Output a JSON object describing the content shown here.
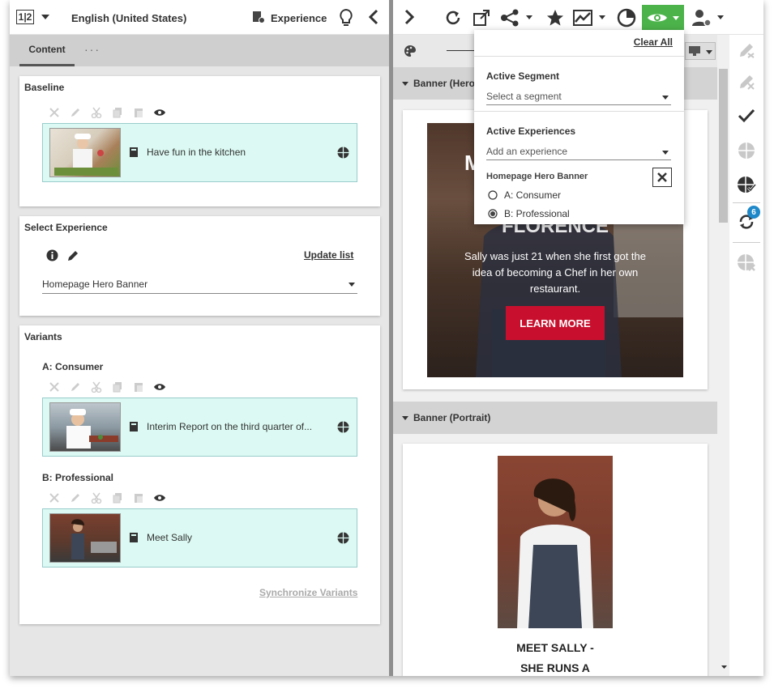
{
  "toolbar": {
    "page_icon_text": "1|2",
    "language": "English (United States)",
    "experience_label": "Experience",
    "visibility_color": "#4cb34a"
  },
  "tabs": {
    "content": "Content",
    "more": "···"
  },
  "baseline": {
    "title": "Baseline",
    "item_label": "Have fun in the kitchen"
  },
  "select_experience": {
    "title": "Select Experience",
    "update_list": "Update list",
    "selected": "Homepage Hero Banner"
  },
  "variants": {
    "title": "Variants",
    "a_title": "A: Consumer",
    "a_item": "Interim Report on the third quarter of...",
    "b_title": "B: Professional",
    "b_item": "Meet Sally",
    "sync": "Synchronize Variants"
  },
  "preview": {
    "hero_header": "Banner (Hero)",
    "hero_title_top": "M",
    "hero_title_2": "FLORENCE",
    "hero_text": "Sally was just 21 when she first got the idea of becoming a Chef in her own restaurant.",
    "hero_button": "LEARN MORE",
    "portrait_header": "Banner (Portrait)",
    "portrait_caption_1": "MEET SALLY -",
    "portrait_caption_2": "SHE RUNS A"
  },
  "dropdown": {
    "clear_all": "Clear All",
    "segment_label": "Active Segment",
    "segment_placeholder": "Select a segment",
    "experiences_label": "Active Experiences",
    "experience_placeholder": "Add an experience",
    "experience_name": "Homepage Hero Banner",
    "option_a": "A: Consumer",
    "option_b": "B: Professional"
  },
  "sidebar": {
    "badge_count": "6"
  }
}
